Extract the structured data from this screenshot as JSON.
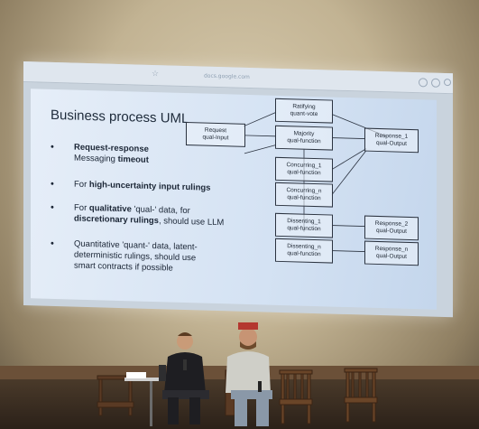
{
  "browser": {
    "url_text": "docs.google.com"
  },
  "slide": {
    "title": "Business process UML",
    "bullets": [
      {
        "pre": "",
        "bold": "Request-response",
        "mid": "",
        "line2_pre": "Messaging ",
        "line2_bold": "timeout",
        "line3": ""
      },
      {
        "pre": "For ",
        "bold": "high-uncertainty input rulings",
        "mid": "",
        "line2_pre": "",
        "line2_bold": "",
        "line3": ""
      },
      {
        "pre": "For ",
        "bold": "qualitative",
        "mid": " 'qual-' data, for",
        "line2_pre": "",
        "line2_bold": "discretionary rulings",
        "line3": ", should use LLM"
      },
      {
        "pre": "Quantitative 'quant-' data, latent-",
        "bold": "",
        "mid": "",
        "line2_pre": "deterministic rulings, should use",
        "line2_bold": "",
        "line3": "smart contracts if possible"
      }
    ],
    "boxes": {
      "ratify": [
        "Ratifying",
        "quant-vote"
      ],
      "request": [
        "Request",
        "qual-Input"
      ],
      "majority": [
        "Majority",
        "qual-function"
      ],
      "response1": [
        "Response_1",
        "qual-Output"
      ],
      "concur1": [
        "Concurring_1",
        "qual-function"
      ],
      "concurn": [
        "Concurring_n",
        "qual-function"
      ],
      "dissent1": [
        "Dissenting_1",
        "qual-function"
      ],
      "response2": [
        "Response_2",
        "qual-Output"
      ],
      "dissentn": [
        "Dissenting_n",
        "qual-function"
      ],
      "responsen": [
        "Response_n",
        "qual-Output"
      ]
    }
  }
}
